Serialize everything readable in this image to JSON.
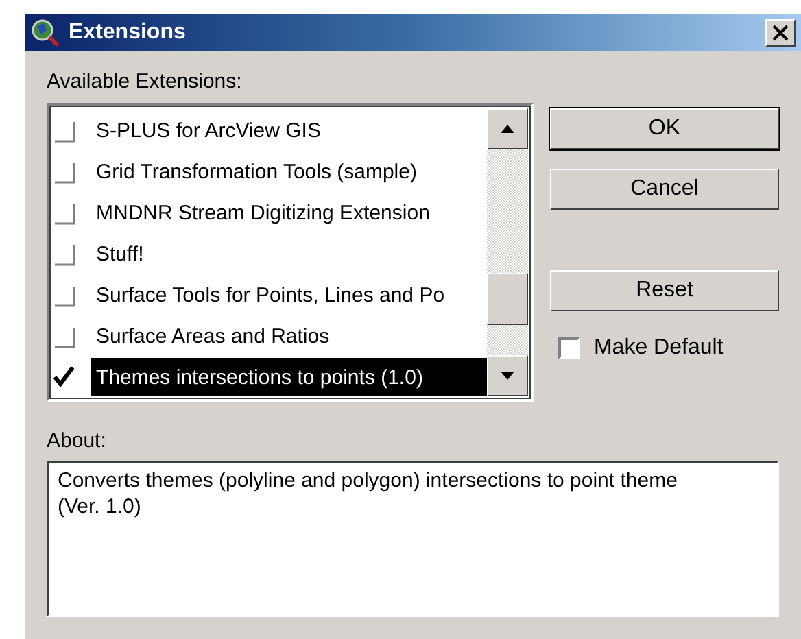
{
  "window": {
    "title": "Extensions"
  },
  "list_label": "Available Extensions:",
  "extensions": [
    {
      "label": "S-PLUS for ArcView GIS",
      "checked": false,
      "selected": false
    },
    {
      "label": "Grid Transformation Tools (sample)",
      "checked": false,
      "selected": false
    },
    {
      "label": "MNDNR Stream Digitizing Extension",
      "checked": false,
      "selected": false
    },
    {
      "label": "Stuff!",
      "checked": false,
      "selected": false
    },
    {
      "label": "Surface Tools for Points, Lines and Po",
      "checked": false,
      "selected": false
    },
    {
      "label": "Surface Areas and Ratios",
      "checked": false,
      "selected": false
    },
    {
      "label": "Themes intersections to points (1.0)",
      "checked": true,
      "selected": true
    }
  ],
  "buttons": [
    {
      "label": "OK",
      "default": true
    },
    {
      "label": "Cancel",
      "default": false
    },
    {
      "label": "Reset",
      "default": false
    }
  ],
  "make_default": {
    "label": "Make Default",
    "checked": false
  },
  "about": {
    "label": "About:",
    "text": "Converts themes (polyline and polygon) intersections to point theme\n(Ver. 1.0)"
  }
}
